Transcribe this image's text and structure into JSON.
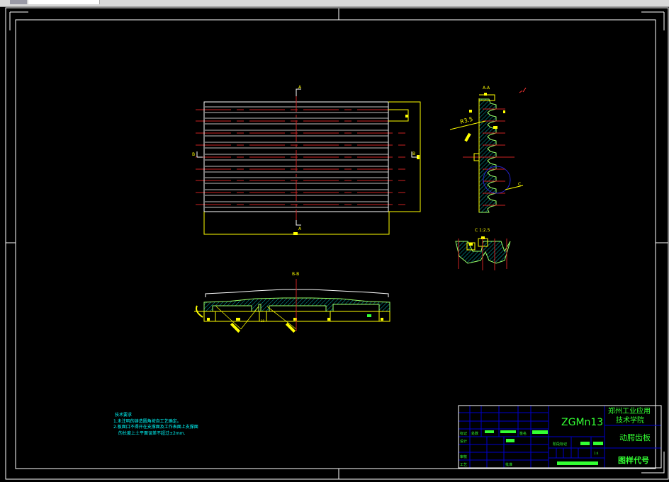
{
  "colors": {
    "background": "#000000",
    "frame": "#ffffff",
    "outline": "#ffff00",
    "center": "#cc2222",
    "hatch": "#00ffff",
    "titleblock_grid": "#0000cc",
    "titleblock_text": "#33ff33",
    "detail_circle": "#2222cc"
  },
  "views": {
    "plan": {
      "section_mark_a": "A",
      "section_mark_b": "B"
    },
    "section_aa": {
      "title": "A-A",
      "radius_label": "R3.5",
      "detail_mark": "C"
    },
    "detail_c": {
      "title": "C 1:2.5"
    },
    "section_bb": {
      "title": "B-B",
      "dim_label": "10"
    }
  },
  "notes": {
    "title": "技术要求",
    "lines": [
      "1.未注明的铸造圆角按自工艺确定。",
      "2.板面口不得开在支撑面及工作表面上支撑面",
      "的长度上土平面误差不超过±2mm."
    ]
  },
  "title_block": {
    "material": "ZGMn13",
    "school_line1": "郑州工业应用",
    "school_line2": "技术学院",
    "part_name": "动腭齿板",
    "drawing_code": "图样代号",
    "scale": "1:4",
    "labels": {
      "mark": "标记",
      "count": "处数",
      "sign": "签名",
      "design": "设计",
      "review": "审核",
      "process": "工艺",
      "approve": "批准",
      "stage": "阶段标记"
    }
  }
}
